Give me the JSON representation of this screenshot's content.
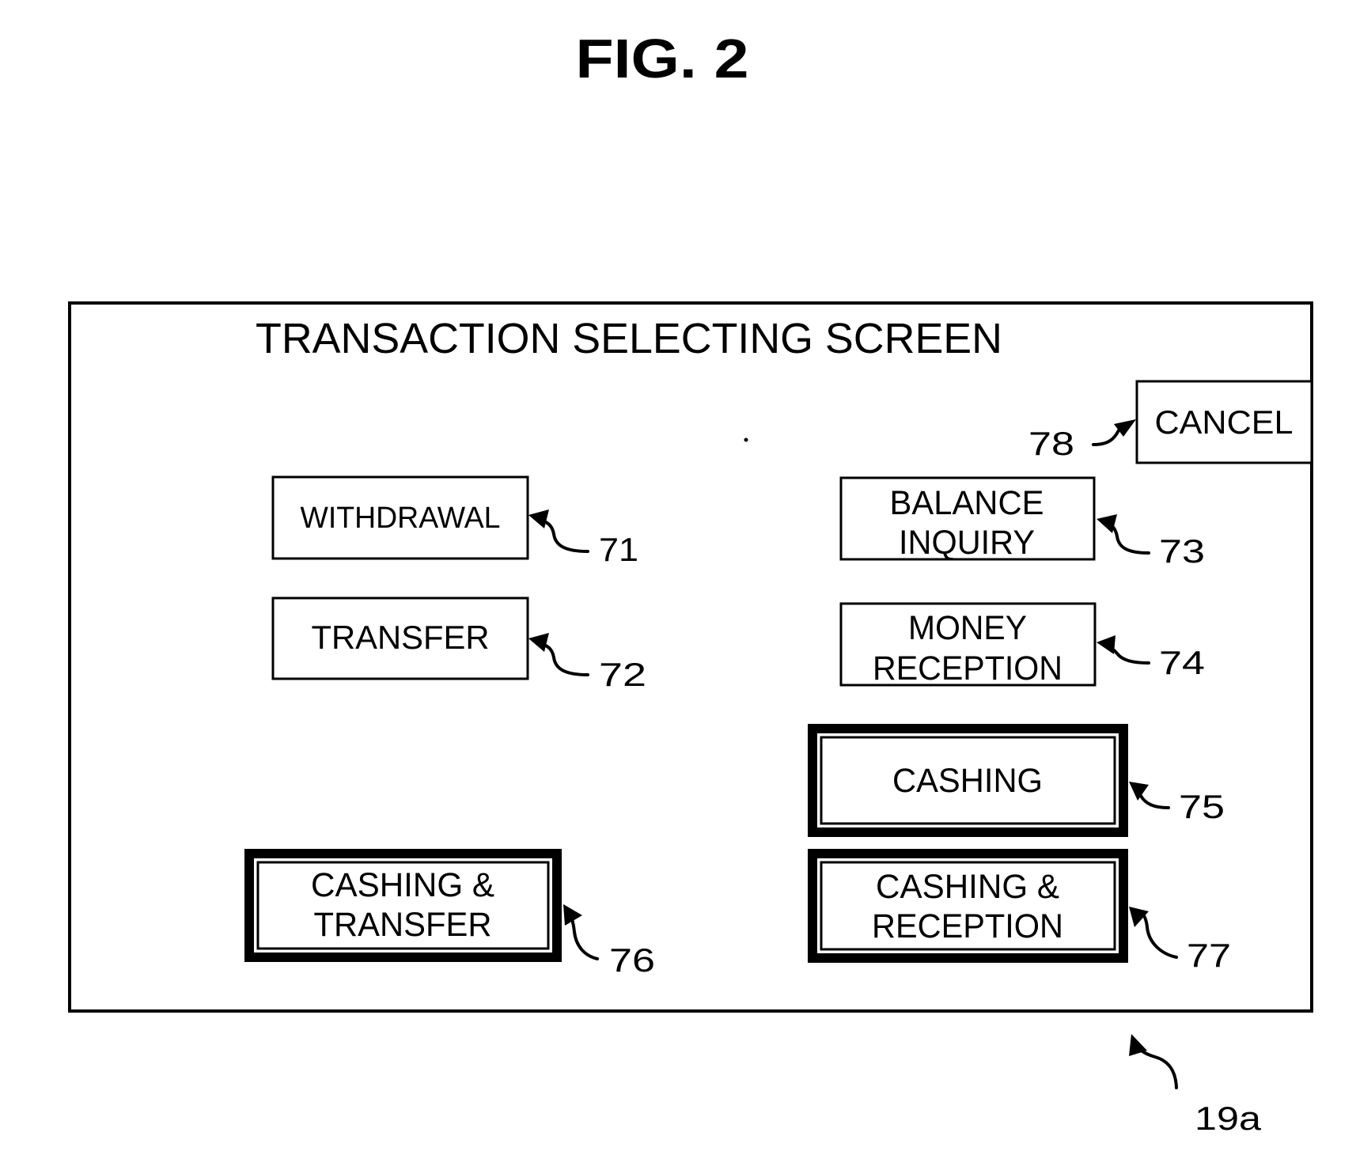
{
  "figure": {
    "title": "FIG. 2",
    "screen_ref": "19a"
  },
  "screen": {
    "title": "TRANSACTION SELECTING SCREEN",
    "cancel_button": {
      "label": "CANCEL",
      "ref": "78"
    },
    "buttons": [
      {
        "id": "withdrawal",
        "lines": [
          "WITHDRAWAL"
        ],
        "ref": "71",
        "style": "normal"
      },
      {
        "id": "transfer",
        "lines": [
          "TRANSFER"
        ],
        "ref": "72",
        "style": "normal"
      },
      {
        "id": "balance-inquiry",
        "lines": [
          "BALANCE",
          "INQUIRY"
        ],
        "ref": "73",
        "style": "normal"
      },
      {
        "id": "money-reception",
        "lines": [
          "MONEY",
          "RECEPTION"
        ],
        "ref": "74",
        "style": "normal"
      },
      {
        "id": "cashing",
        "lines": [
          "CASHING"
        ],
        "ref": "75",
        "style": "emphasized"
      },
      {
        "id": "cashing-and-transfer",
        "lines": [
          "CASHING &",
          "TRANSFER"
        ],
        "ref": "76",
        "style": "emphasized"
      },
      {
        "id": "cashing-and-reception",
        "lines": [
          "CASHING &",
          "RECEPTION"
        ],
        "ref": "77",
        "style": "emphasized"
      }
    ]
  }
}
